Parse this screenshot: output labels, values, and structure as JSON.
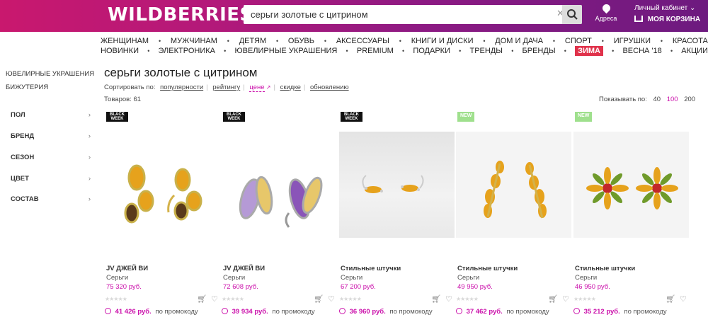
{
  "header": {
    "logo": "WILDBERRIES",
    "search_value": "серьги золотые с цитрином",
    "address_label": "Адреса",
    "cabinet_label": "Личный кабинет",
    "cart_label": "МОЯ КОРЗИНА"
  },
  "nav": {
    "row1": [
      "ЖЕНЩИНАМ",
      "МУЖЧИНАМ",
      "ДЕТЯМ",
      "ОБУВЬ",
      "АКСЕССУАРЫ",
      "КНИГИ И ДИСКИ",
      "ДОМ И ДАЧА",
      "СПОРТ",
      "ИГРУШКИ",
      "КРАСОТА"
    ],
    "row2": [
      "НОВИНКИ",
      "ЭЛЕКТРОНИКА",
      "ЮВЕЛИРНЫЕ УКРАШЕНИЯ",
      "PREMIUM",
      "ПОДАРКИ",
      "ТРЕНДЫ",
      "БРЕНДЫ",
      "ЗИМА",
      "ВЕСНА '18",
      "АКЦИИ"
    ],
    "highlight": "ЗИМА"
  },
  "sidebar": {
    "links": [
      "ЮВЕЛИРНЫЕ УКРАШЕНИЯ",
      "БИЖУТЕРИЯ"
    ],
    "filters": [
      "ПОЛ",
      "БРЕНД",
      "СЕЗОН",
      "ЦВЕТ",
      "СОСТАВ"
    ]
  },
  "main": {
    "title": "серьги золотые с цитрином",
    "sort_label": "Сортировать по:",
    "sort_options": [
      "популярности",
      "рейтингу",
      "цене",
      "скидке",
      "обновлению"
    ],
    "sort_active": "цене",
    "count_label": "Товаров: 61",
    "perpage_label": "Показывать по:",
    "perpage_options": [
      "40",
      "100",
      "200"
    ],
    "perpage_active": "100"
  },
  "promo_suffix": "по промокоду",
  "products": [
    {
      "badge": "BLACK WEEK",
      "badge_type": "bw",
      "brand": "JV ДЖЕЙ ВИ",
      "category": "Серьги",
      "price": "75 320 руб.",
      "promo_price": "41 426 руб.",
      "image": "citrine-smoky-quartz-earrings"
    },
    {
      "badge": "BLACK WEEK",
      "badge_type": "bw",
      "brand": "JV ДЖЕЙ ВИ",
      "category": "Серьги",
      "price": "72 608 руб.",
      "promo_price": "39 934 руб.",
      "image": "amethyst-citrine-earrings"
    },
    {
      "badge": "BLACK WEEK",
      "badge_type": "bw",
      "brand": "Стильные штучки",
      "category": "Серьги",
      "price": "67 200 руб.",
      "promo_price": "36 960 руб.",
      "image": "citrine-marquise-earrings"
    },
    {
      "badge": "NEW",
      "badge_type": "new",
      "brand": "Стильные штучки",
      "category": "Серьги",
      "price": "49 950 руб.",
      "promo_price": "37 462 руб.",
      "image": "citrine-cluster-earrings"
    },
    {
      "badge": "NEW",
      "badge_type": "new",
      "brand": "Стильные штучки",
      "category": "Серьги",
      "price": "46 950 руб.",
      "promo_price": "35 212 руб.",
      "image": "flower-citrine-earrings"
    }
  ],
  "colors": {
    "accent": "#cb11ab",
    "header_start": "#c9186e",
    "header_end": "#6d1a7f",
    "winter_badge": "#e0324b"
  }
}
